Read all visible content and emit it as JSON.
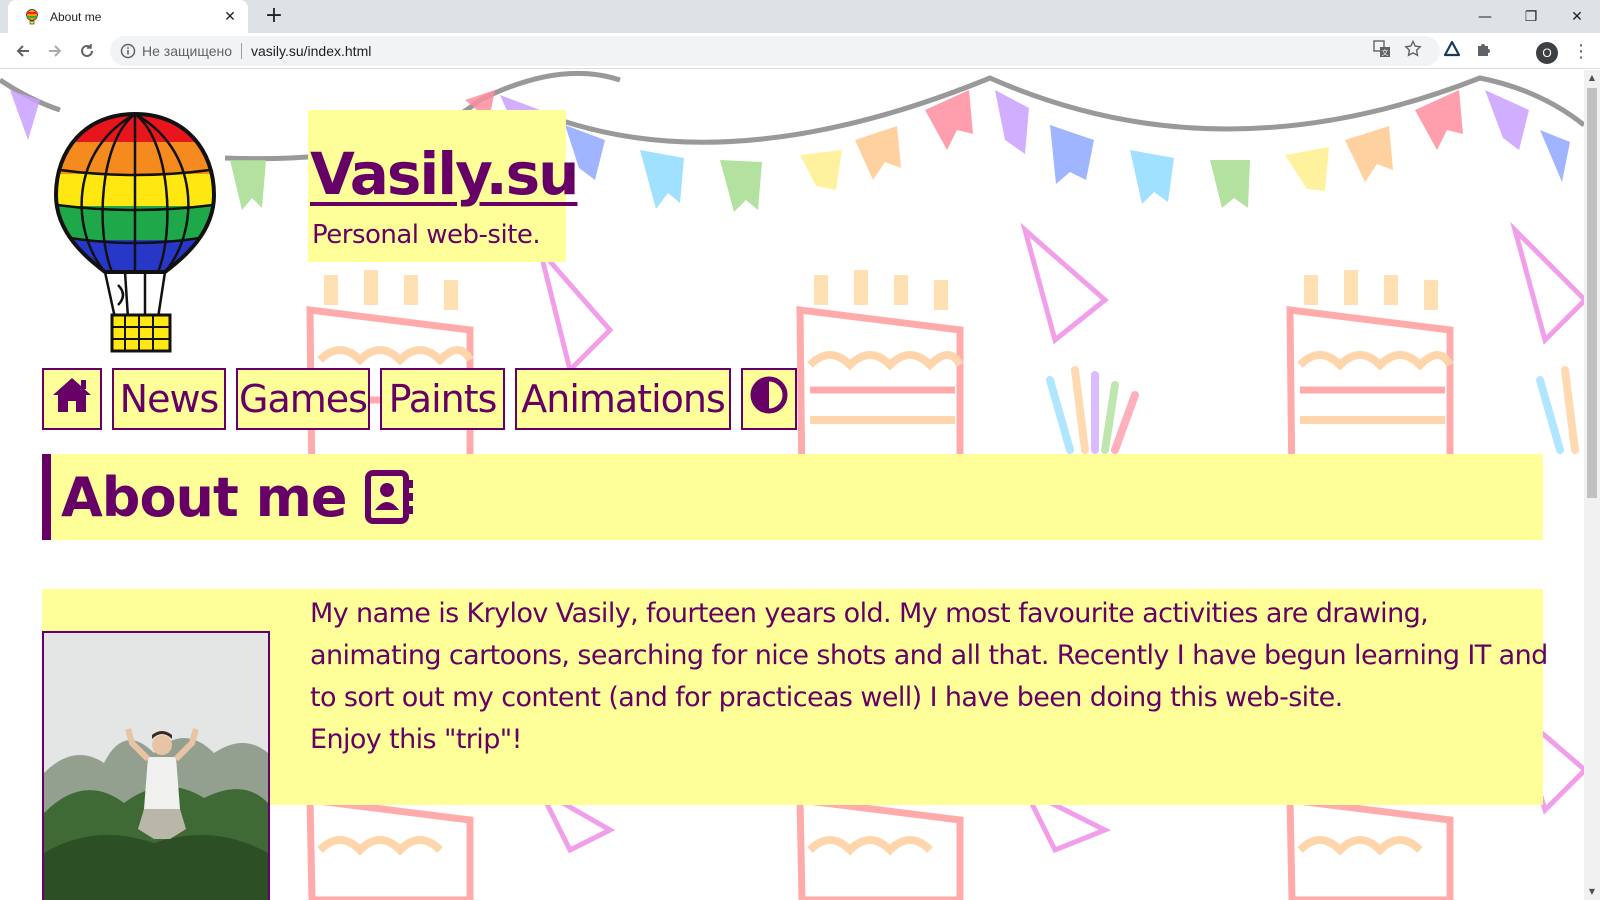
{
  "browser": {
    "tab_title": "About me",
    "tab_close": "✕",
    "new_tab": "+",
    "security_label": "Не защищено",
    "url": "vasily.su/index.html",
    "profile_initial": "O",
    "controls": {
      "minimize": "—",
      "restore": "❐",
      "close": "✕"
    }
  },
  "site": {
    "title": "Vasily.su",
    "subtitle": "Personal web-site."
  },
  "nav": {
    "items": [
      {
        "label": "",
        "icon": "home-icon"
      },
      {
        "label": "News"
      },
      {
        "label": "Games"
      },
      {
        "label": "Paints"
      },
      {
        "label": "Animations"
      },
      {
        "label": "",
        "icon": "contrast-icon"
      }
    ]
  },
  "about": {
    "heading": "About me",
    "heading_icon": "contact-card-icon",
    "paragraph": "My name is Krylov Vasily, fourteen years old. My most favourite activities are drawing, animating cartoons, searching for nice shots and all that. Recently I have begun learning IT and to sort out my content (and for practiceas well) I have been doing this web-site.",
    "closing": "Enjoy this \"trip\"!"
  },
  "colors": {
    "accent": "#660066",
    "panel": "#ffff99"
  }
}
